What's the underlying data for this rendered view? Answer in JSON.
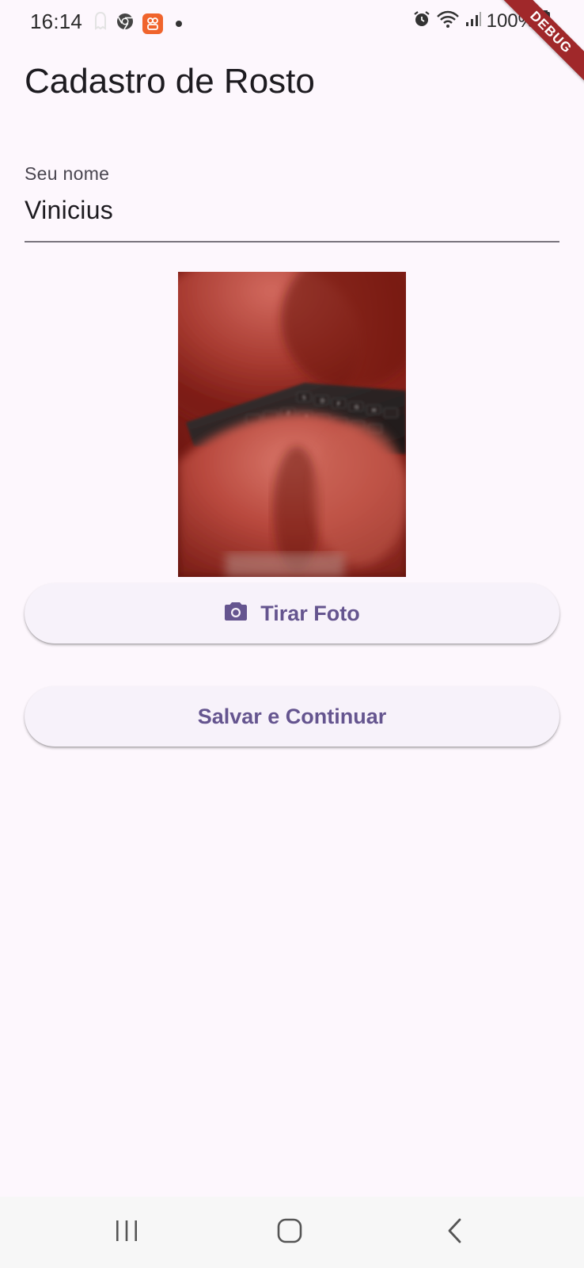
{
  "status_bar": {
    "time": "16:14",
    "battery": "100%",
    "icons": [
      "notification-ghost-icon",
      "chrome-icon",
      "app-notification-icon",
      "dot-icon",
      "alarm-icon",
      "wifi-icon",
      "signal-icon",
      "battery-icon"
    ]
  },
  "debug_banner": "DEBUG",
  "page": {
    "title": "Cadastro de Rosto"
  },
  "name_field": {
    "label": "Seu nome",
    "value": "Vinicius"
  },
  "photo_preview": {
    "description_icon": "captured-photo"
  },
  "buttons": {
    "take_photo": "Tirar Foto",
    "take_photo_icon": "camera-icon",
    "save_continue": "Salvar e Continuar"
  },
  "nav_bar": {
    "icons": [
      "recents-icon",
      "home-icon",
      "back-icon"
    ]
  },
  "colors": {
    "background": "#FDF7FD",
    "button_background": "#F7F2FA",
    "accent": "#65558F",
    "debug_ribbon": "#A0282A",
    "field_underline": "#79747E"
  }
}
